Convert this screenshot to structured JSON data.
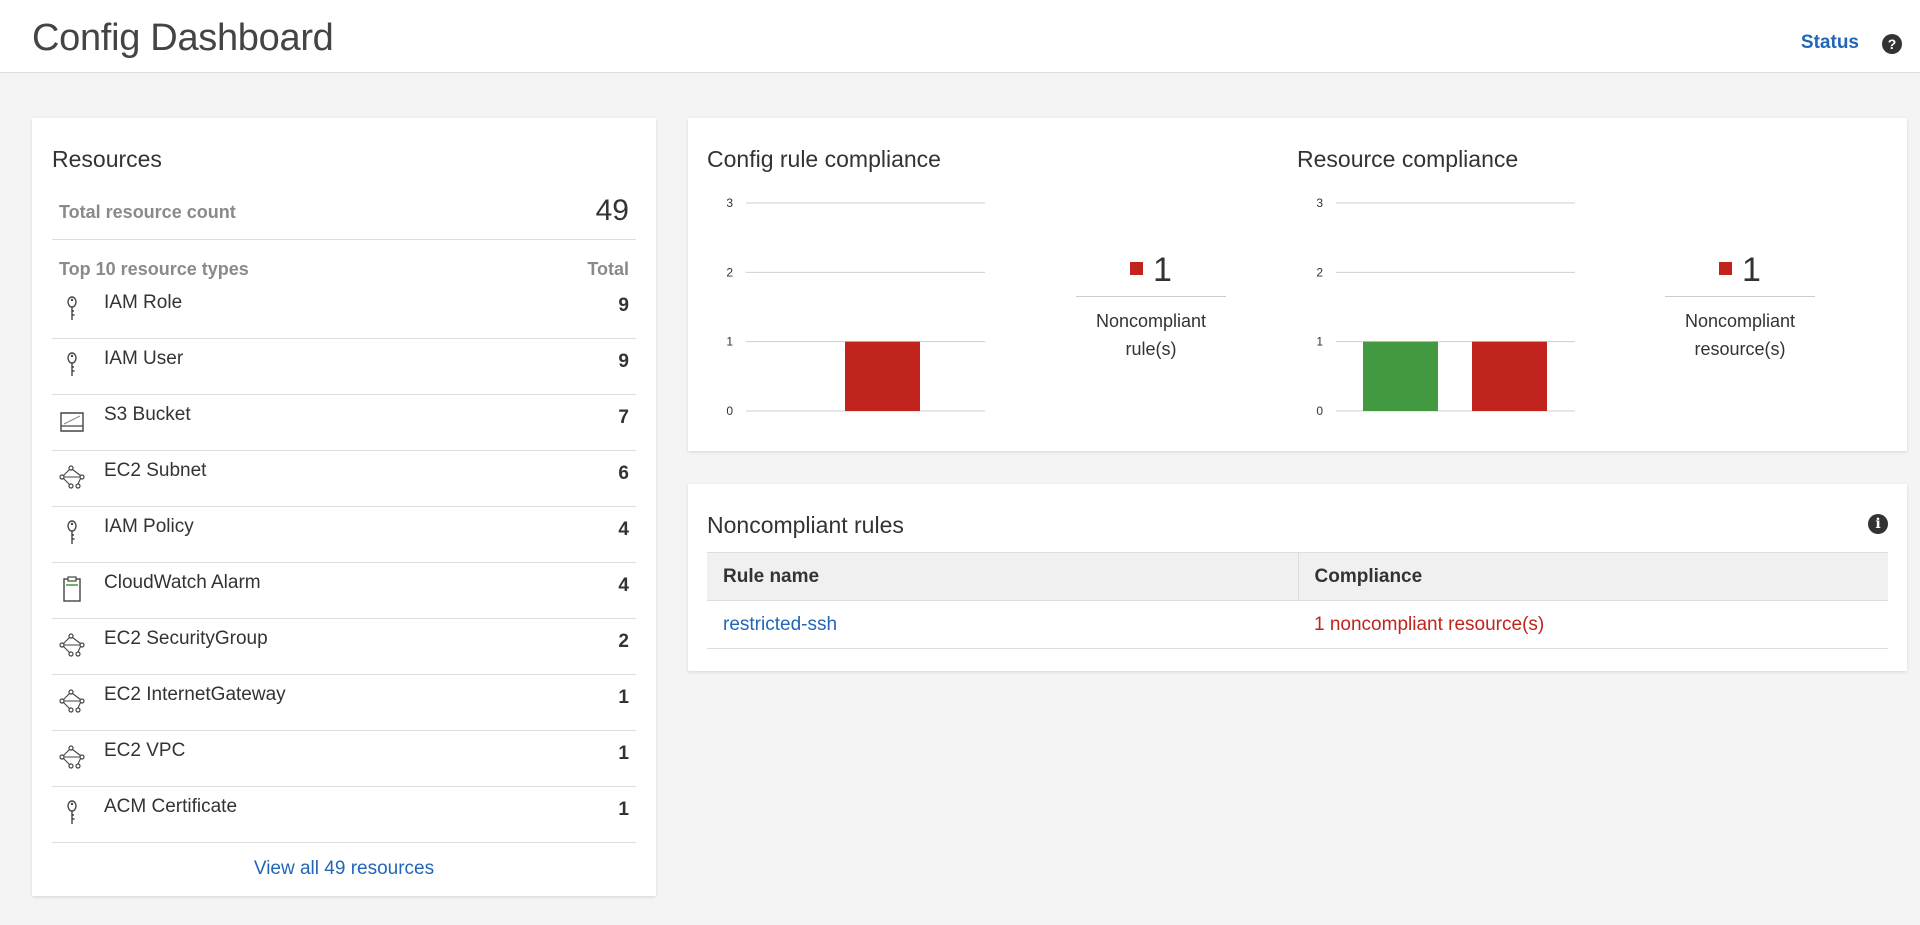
{
  "header": {
    "title": "Config Dashboard",
    "status_link": "Status",
    "help_icon": "question-circle-icon"
  },
  "resources": {
    "title": "Resources",
    "total_label": "Total resource count",
    "total_value": "49",
    "types_header": "Top 10 resource types",
    "total_header": "Total",
    "items": [
      {
        "name": "IAM Role",
        "count": "9",
        "icon": "key-icon"
      },
      {
        "name": "IAM User",
        "count": "9",
        "icon": "key-icon"
      },
      {
        "name": "S3 Bucket",
        "count": "7",
        "icon": "bucket-icon"
      },
      {
        "name": "EC2 Subnet",
        "count": "6",
        "icon": "network-icon"
      },
      {
        "name": "IAM Policy",
        "count": "4",
        "icon": "key-icon"
      },
      {
        "name": "CloudWatch Alarm",
        "count": "4",
        "icon": "clipboard-icon"
      },
      {
        "name": "EC2 SecurityGroup",
        "count": "2",
        "icon": "network-icon"
      },
      {
        "name": "EC2 InternetGateway",
        "count": "1",
        "icon": "network-icon"
      },
      {
        "name": "EC2 VPC",
        "count": "1",
        "icon": "network-icon"
      },
      {
        "name": "ACM Certificate",
        "count": "1",
        "icon": "key-icon"
      }
    ],
    "view_all": "View all 49 resources"
  },
  "compliance": {
    "rule_title": "Config rule compliance",
    "rule_legend_count": "1",
    "rule_legend_line1": "Noncompliant",
    "rule_legend_line2": "rule(s)",
    "resource_title": "Resource compliance",
    "resource_legend_count": "1",
    "resource_legend_line1": "Noncompliant",
    "resource_legend_line2": "resource(s)"
  },
  "chart_data": [
    {
      "type": "bar",
      "title": "Config rule compliance",
      "ylim": [
        0,
        3
      ],
      "yticks": [
        "0",
        "1",
        "2",
        "3"
      ],
      "series": [
        {
          "name": "Noncompliant",
          "color": "#c0241c",
          "values": [
            1
          ]
        }
      ],
      "grid": true
    },
    {
      "type": "bar",
      "title": "Resource compliance",
      "ylim": [
        0,
        3
      ],
      "yticks": [
        "0",
        "1",
        "2",
        "3"
      ],
      "series": [
        {
          "name": "",
          "color": "#43993f",
          "values": [
            1
          ]
        },
        {
          "name": "Noncompliant",
          "color": "#c0241c",
          "values": [
            1
          ]
        }
      ],
      "grid": true
    }
  ],
  "rules": {
    "title": "Noncompliant rules",
    "info_icon": "info-circle-icon",
    "col_rule": "Rule name",
    "col_compliance": "Compliance",
    "rows": [
      {
        "rule": "restricted-ssh",
        "compliance": "1 noncompliant resource(s)"
      }
    ]
  },
  "colors": {
    "link": "#2166b8",
    "noncompliant": "#c0241c",
    "compliant": "#43993f"
  }
}
